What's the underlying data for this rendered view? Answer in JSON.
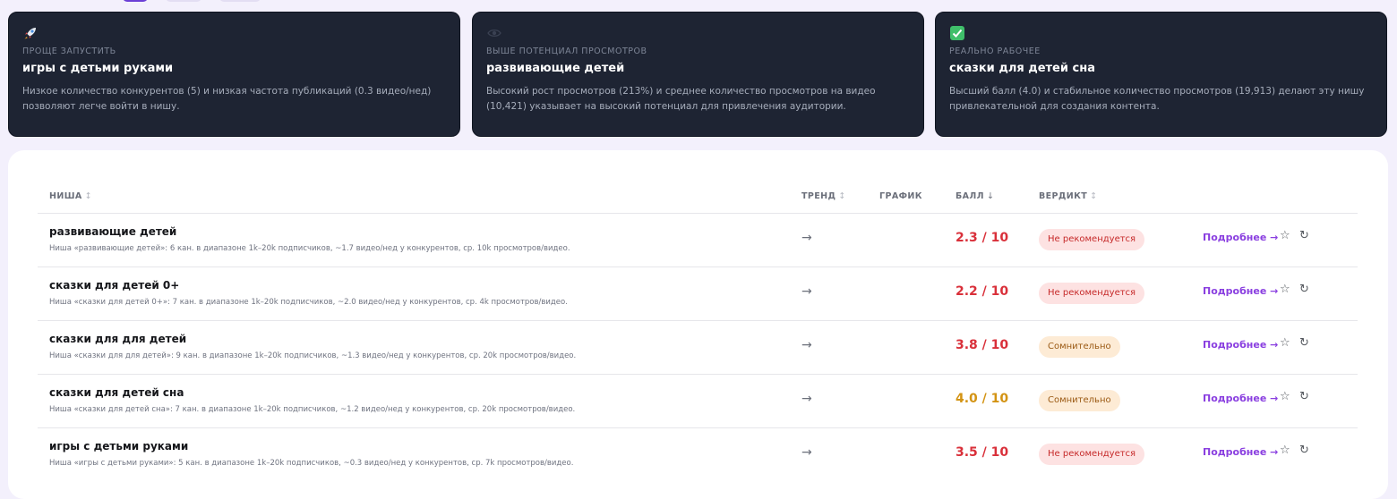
{
  "colors": {
    "score_red": "#d9303a",
    "score_orange": "#d39313",
    "link_purple": "#8a3fe0"
  },
  "insights": [
    {
      "icon": "rocket-icon",
      "category": "ПРОЩЕ ЗАПУСТИТЬ",
      "title": "игры с детьми руками",
      "desc1": "Низкое количество конкурентов (5) и низкая частота публикаций (0.3 видео/нед)",
      "desc2": "позволяют легче войти в нишу."
    },
    {
      "icon": "eye-icon",
      "category": "ВЫШЕ ПОТЕНЦИАЛ ПРОСМОТРОВ",
      "title": "развивающие детей",
      "desc1": "Высокий рост просмотров (213%) и среднее количество просмотров на видео",
      "desc2": "(10,421) указывает на высокий потенциал для привлечения аудитории."
    },
    {
      "icon": "check-mark-icon",
      "category": "РЕАЛЬНО РАБОЧЕЕ",
      "title": "сказки для детей сна",
      "desc1": "Высший балл (4.0) и стабильное количество просмотров (19,913) делают эту нишу",
      "desc2": "привлекательной для создания контента."
    }
  ],
  "table": {
    "headers": {
      "niche": "НИША",
      "trend": "ТРЕНД",
      "chart": "ГРАФИК",
      "score": "БАЛЛ",
      "verdict": "ВЕРДИКТ"
    },
    "sort_neutral": "↕",
    "sort_down": "↓",
    "rows": [
      {
        "name": "развивающие детей",
        "sub": "Ниша «развивающие детей»: 6 кан. в диапазоне 1k–20k подписчиков, ~1.7 видео/нед у конкурентов, ср. 10k просмотров/видео.",
        "trend": "→",
        "score": "2.3 / 10",
        "verdict": "Не рекомендуется",
        "more": "Подробнее →",
        "star": "☆",
        "refresh": "↻"
      },
      {
        "name": "сказки для детей 0+",
        "sub": "Ниша «сказки для детей 0+»: 7 кан. в диапазоне 1k–20k подписчиков, ~2.0 видео/нед у конкурентов, ср. 4k просмотров/видео.",
        "trend": "→",
        "score": "2.2 / 10",
        "verdict": "Не рекомендуется",
        "more": "Подробнее →",
        "star": "☆",
        "refresh": "↻"
      },
      {
        "name": "сказки для для детей",
        "sub": "Ниша «сказки для для детей»: 9 кан. в диапазоне 1k–20k подписчиков, ~1.3 видео/нед у конкурентов, ср. 20k просмотров/видео.",
        "trend": "→",
        "score": "3.8 / 10",
        "verdict": "Сомнительно",
        "more": "Подробнее →",
        "star": "☆",
        "refresh": "↻"
      },
      {
        "name": "сказки для детей сна",
        "sub": "Ниша «сказки для детей сна»: 7 кан. в диапазоне 1k–20k подписчиков, ~1.2 видео/нед у конкурентов, ср. 20k просмотров/видео.",
        "trend": "→",
        "score": "4.0 / 10",
        "verdict": "Сомнительно",
        "more": "Подробнее →",
        "star": "☆",
        "refresh": "↻"
      },
      {
        "name": "игры с детьми руками",
        "sub": "Ниша «игры с детьми руками»: 5 кан. в диапазоне 1k–20k подписчиков, ~0.3 видео/нед у конкурентов, ср. 7k просмотров/видео.",
        "trend": "→",
        "score": "3.5 / 10",
        "verdict": "Не рекомендуется",
        "more": "Подробнее →",
        "star": "☆",
        "refresh": "↻"
      }
    ]
  }
}
